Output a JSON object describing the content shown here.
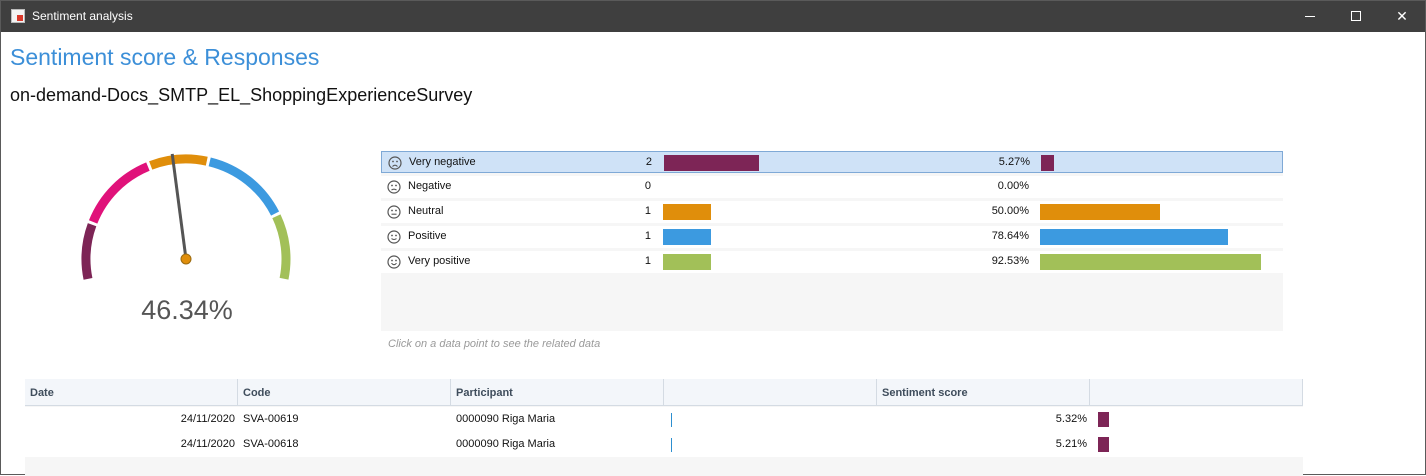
{
  "window": {
    "title": "Sentiment analysis",
    "minimize": "",
    "maximize": "",
    "close": "✕"
  },
  "header": {
    "title": "Sentiment score & Responses",
    "survey": "on-demand-Docs_SMTP_EL_ShoppingExperienceSurvey"
  },
  "gauge": {
    "value": 46.34,
    "value_text": "46.34%",
    "segment_colors": [
      "#7d2556",
      "#e0127a",
      "#e08e0b",
      "#3c9ae0",
      "#a2c058"
    ],
    "needle_color": "#555555",
    "pivot_color": "#e08e0b"
  },
  "distribution": {
    "rows": [
      {
        "label": "Very negative",
        "icon": "very-negative-face-icon",
        "count": 2,
        "count_text": "2",
        "count_share": 1.0,
        "percent": 5.27,
        "percent_text": "5.27%",
        "color": "#7d2556",
        "selected": true
      },
      {
        "label": "Negative",
        "icon": "negative-face-icon",
        "count": 0,
        "count_text": "0",
        "count_share": 0,
        "percent": 0,
        "percent_text": "0.00%",
        "color": "#e0127a",
        "selected": false
      },
      {
        "label": "Neutral",
        "icon": "neutral-face-icon",
        "count": 1,
        "count_text": "1",
        "count_share": 0.5,
        "percent": 50.0,
        "percent_text": "50.00%",
        "color": "#e08e0b",
        "selected": false
      },
      {
        "label": "Positive",
        "icon": "positive-face-icon",
        "count": 1,
        "count_text": "1",
        "count_share": 0.5,
        "percent": 78.64,
        "percent_text": "78.64%",
        "color": "#3c9ae0",
        "selected": false
      },
      {
        "label": "Very positive",
        "icon": "very-positive-face-icon",
        "count": 1,
        "count_text": "1",
        "count_share": 0.5,
        "percent": 92.53,
        "percent_text": "92.53%",
        "color": "#a2c058",
        "selected": false
      }
    ],
    "hint": "Click on a data point to see the related data"
  },
  "table": {
    "columns": [
      "Date",
      "Code",
      "Participant",
      "",
      "Sentiment score",
      ""
    ],
    "rows": [
      {
        "date": "24/11/2020",
        "code": "SVA-00619",
        "participant": "0000090 Riga Maria",
        "score": "5.32%"
      },
      {
        "date": "24/11/2020",
        "code": "SVA-00618",
        "participant": "0000090 Riga Maria",
        "score": "5.21%"
      }
    ]
  }
}
